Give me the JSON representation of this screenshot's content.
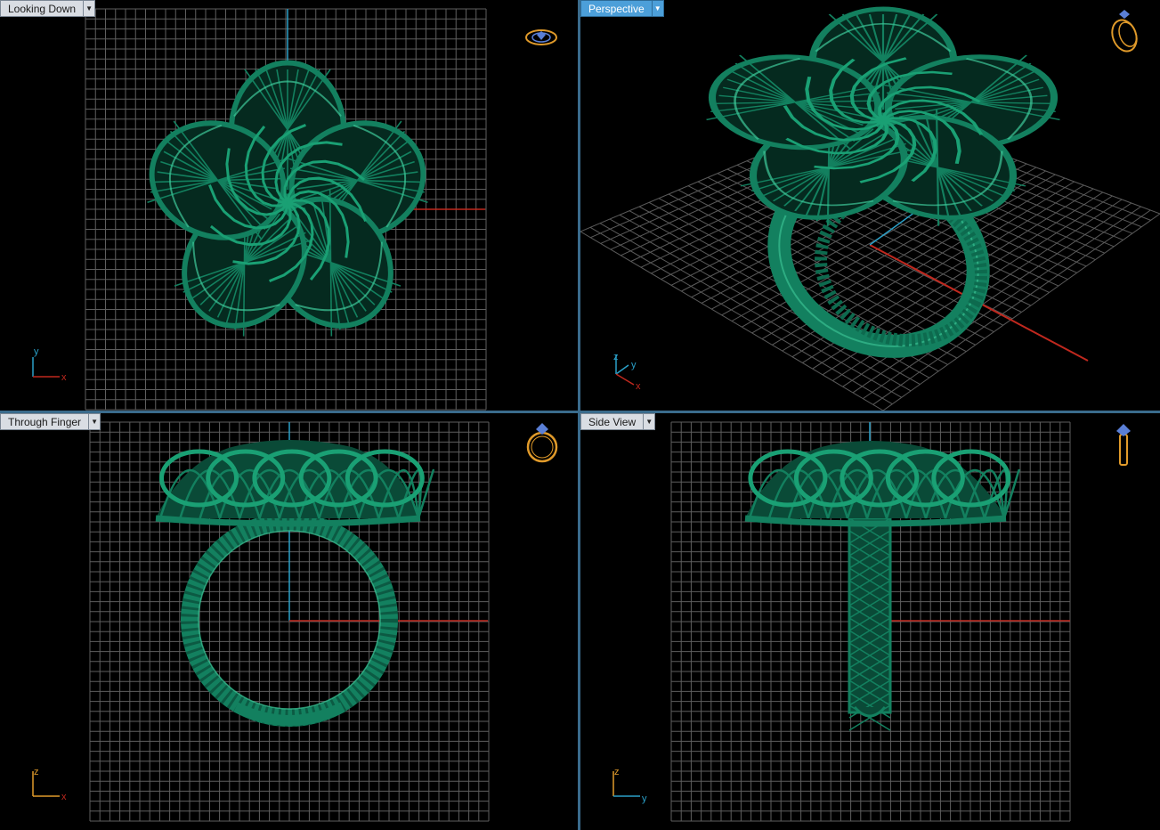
{
  "viewports": {
    "top": {
      "label": "Looking Down",
      "axis_v": "y",
      "axis_h": "x",
      "active": false
    },
    "perspective": {
      "label": "Perspective",
      "axis_v": "z",
      "axis_h": "y",
      "axis_d": "x",
      "active": true
    },
    "front": {
      "label": "Through Finger",
      "axis_v": "z",
      "axis_h": "x",
      "active": false
    },
    "side": {
      "label": "Side View",
      "axis_v": "z",
      "axis_h": "y",
      "active": false
    }
  },
  "colors": {
    "model": "#13805f",
    "model_highlight": "#3fc99a",
    "model_shadow": "#0a4a37",
    "grid": "#6a6a6a",
    "axis_x": "#c0281e",
    "axis_y": "#2aa0c8",
    "nav_icon": "#e09a2a"
  },
  "icons": {
    "top": "ring-top-view-icon",
    "perspective": "ring-perspective-icon",
    "front": "ring-front-view-icon",
    "side": "ring-side-view-icon",
    "dropdown": "chevron-down-icon"
  }
}
